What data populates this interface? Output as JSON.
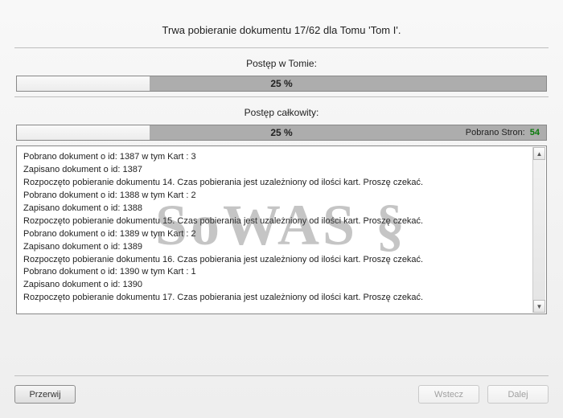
{
  "title": "Trwa pobieranie dokumentu 17/62  dla Tomu 'Tom I'.",
  "volume": {
    "label": "Postęp w Tomie:",
    "percent_text": "25 %",
    "percent": 25
  },
  "total": {
    "label": "Postęp całkowity:",
    "percent_text": "25 %",
    "percent": 25,
    "pages_label": "Pobrano Stron:",
    "pages_count": "54"
  },
  "log": [
    "Pobrano dokument o id: 1387  w tym Kart : 3",
    "Zapisano dokument o id: 1387",
    "Rozpoczęto pobieranie dokumentu 14. Czas pobierania jest uzależniony od ilości kart. Proszę czekać.",
    "Pobrano dokument o id: 1388  w tym Kart : 2",
    "Zapisano dokument o id: 1388",
    "Rozpoczęto pobieranie dokumentu 15. Czas pobierania jest uzależniony od ilości kart. Proszę czekać.",
    "Pobrano dokument o id: 1389  w tym Kart : 2",
    "Zapisano dokument o id: 1389",
    "Rozpoczęto pobieranie dokumentu 16. Czas pobierania jest uzależniony od ilości kart. Proszę czekać.",
    "Pobrano dokument o id: 1390  w tym Kart : 1",
    "Zapisano dokument o id: 1390",
    "Rozpoczęto pobieranie dokumentu 17. Czas pobierania jest uzależniony od ilości kart. Proszę czekać."
  ],
  "watermark": "SoWAS §",
  "buttons": {
    "cancel": "Przerwij",
    "back": "Wstecz",
    "next": "Dalej"
  }
}
